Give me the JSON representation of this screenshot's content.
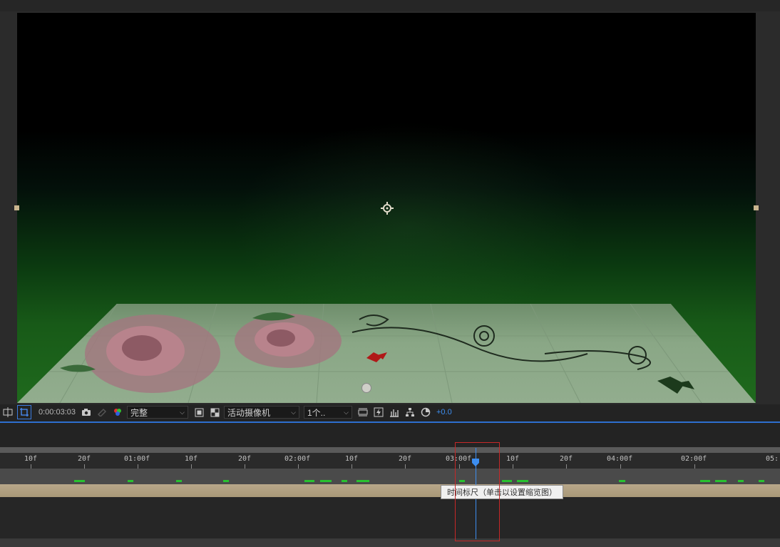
{
  "viewer": {
    "background": "#000000",
    "floor_color": "#8aa786"
  },
  "toolbar": {
    "icons": [
      "grid-icon",
      "region-of-interest-icon",
      "camera-snapshot-icon",
      "show-snapshot-icon",
      "color-channel-icon",
      "fit-icon",
      "transparency-grid-icon",
      "view-layout-icon",
      "fast-preview-icon",
      "timeline-icon",
      "flowchart-icon",
      "exposure-reset-icon"
    ],
    "timecode": "0:00:03:03",
    "resolution": "完整",
    "camera": "活动摄像机",
    "views": "1个..",
    "exposure": "+0.0"
  },
  "timeline": {
    "ticks": [
      "10f",
      "20f",
      "01:00f",
      "10f",
      "20f",
      "02:00f",
      "10f",
      "20f",
      "03:00f",
      "10f",
      "20f",
      "04:00f",
      "02:00f",
      "05:"
    ],
    "tooltip": "时间标尺（单击以设置缩览图）",
    "colors": {
      "accent": "#3d8ef0",
      "cache": "#27c22f",
      "highlight": "#c62828"
    }
  }
}
